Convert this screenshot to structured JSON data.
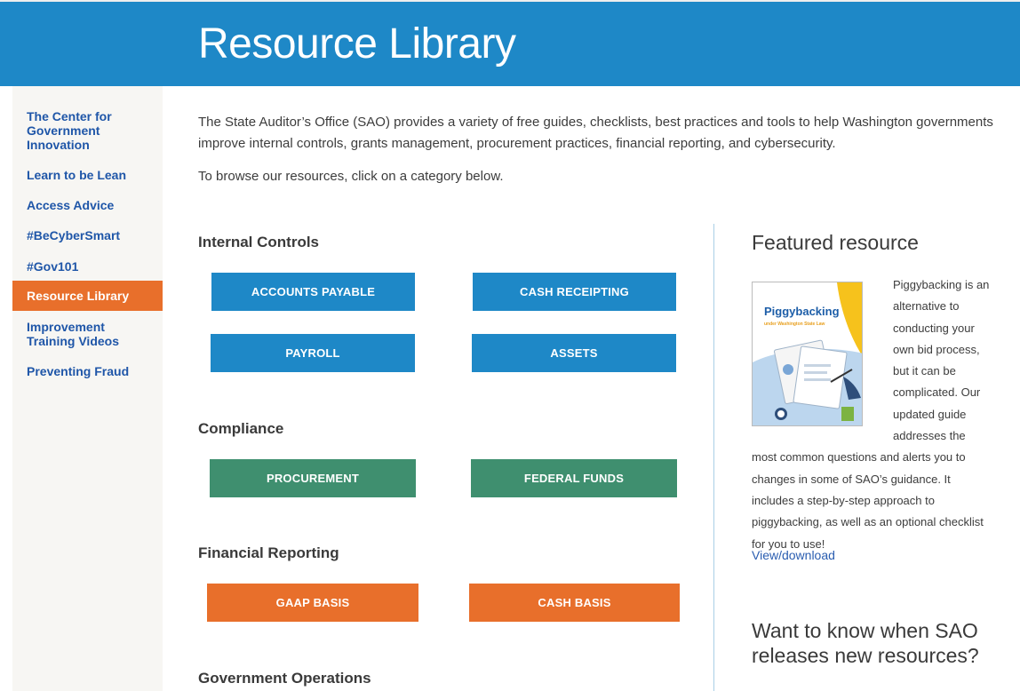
{
  "header": {
    "title": "Resource Library"
  },
  "sidebar": {
    "items": [
      {
        "label": "The Center for Government Innovation"
      },
      {
        "label": "Learn to be Lean"
      },
      {
        "label": "Access Advice"
      },
      {
        "label": "#BeCyberSmart"
      },
      {
        "label": "#Gov101"
      },
      {
        "label": "Resource Library",
        "active": true
      },
      {
        "label": "Improvement Training Videos"
      },
      {
        "label": "Preventing Fraud"
      }
    ]
  },
  "intro": {
    "paragraph": "The State Auditor’s Office (SAO) provides a variety of free guides, checklists, best practices and tools to help Washington governments improve internal controls, grants management, procurement practices, financial reporting, and cybersecurity.",
    "browse": "To browse our resources, click on a category below."
  },
  "sections": {
    "internal_controls": {
      "title": "Internal Controls",
      "buttons": [
        "ACCOUNTS PAYABLE",
        "CASH RECEIPTING",
        "PAYROLL",
        "ASSETS"
      ]
    },
    "compliance": {
      "title": "Compliance",
      "buttons": [
        "PROCUREMENT",
        "FEDERAL FUNDS"
      ]
    },
    "financial_reporting": {
      "title": "Financial Reporting",
      "buttons": [
        "GAAP BASIS",
        "CASH BASIS"
      ]
    },
    "government_operations": {
      "title": "Government Operations"
    }
  },
  "featured": {
    "title": "Featured resource",
    "cover_title": "Piggybacking",
    "cover_subtitle": "under Washington State Law",
    "text": "Piggybacking is an alternative to conducting your own bid process, but it can be complicated. Our updated guide addresses the most common questions and alerts you to changes in some of SAO’s guidance. It includes a step-by-step approach to piggybacking, as well as an optional checklist for you to use!",
    "link": "View/download"
  },
  "notify": {
    "title": "Want to know when SAO releases new resources?"
  },
  "colors": {
    "header_blue": "#1e88c7",
    "accent_orange": "#e86f2b",
    "compliance_green": "#3f8f6f",
    "nav_link": "#1f56a8"
  }
}
